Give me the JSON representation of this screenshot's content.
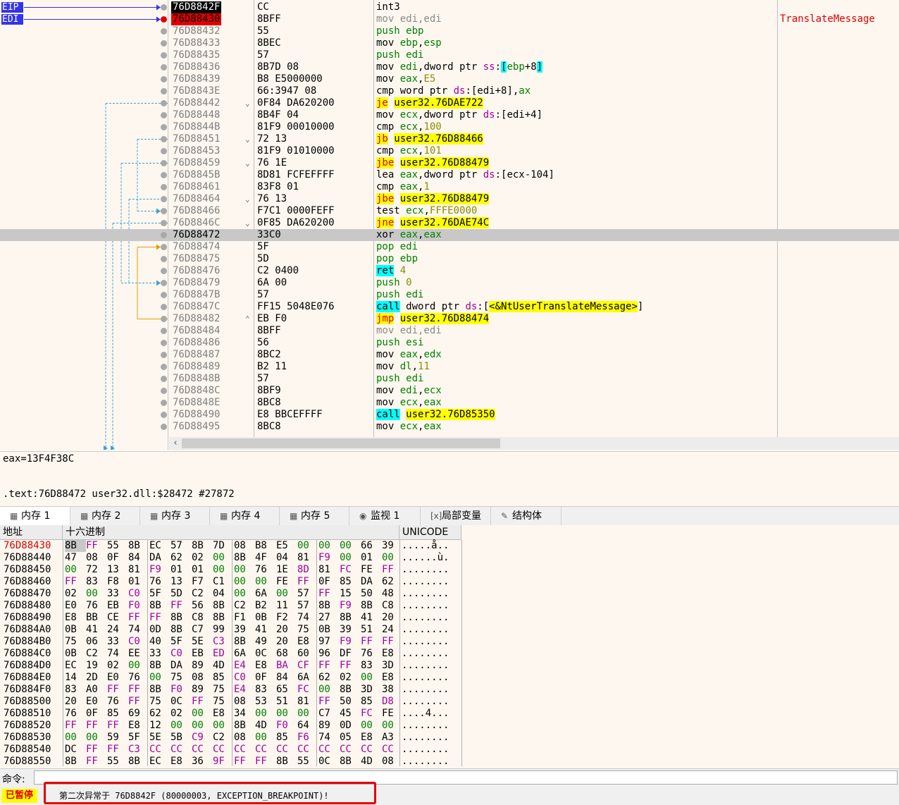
{
  "registers": [
    "EIP",
    "EDI"
  ],
  "disasm": [
    {
      "addr": "76D8842F",
      "bytes": "CC",
      "instr": [
        [
          "m",
          "int3"
        ]
      ],
      "comment": "",
      "state": "eip"
    },
    {
      "addr": "76D88430",
      "bytes": "8BFF",
      "instr": [
        [
          "g",
          "mov edi,edi"
        ]
      ],
      "comment": "TranslateMessage",
      "state": "bp"
    },
    {
      "addr": "76D88432",
      "bytes": "55",
      "instr": [
        [
          "r",
          "push ebp"
        ]
      ]
    },
    {
      "addr": "76D88433",
      "bytes": "8BEC",
      "instr": [
        [
          "p",
          "mov "
        ],
        [
          "r",
          "ebp"
        ],
        [
          "p",
          ","
        ],
        [
          "r",
          "esp"
        ]
      ]
    },
    {
      "addr": "76D88435",
      "bytes": "57",
      "instr": [
        [
          "r",
          "push edi"
        ]
      ]
    },
    {
      "addr": "76D88436",
      "bytes": "8B7D 08",
      "instr": [
        [
          "p",
          "mov "
        ],
        [
          "r",
          "edi"
        ],
        [
          "p",
          ",dword ptr "
        ],
        [
          "seg",
          "ss"
        ],
        [
          "p",
          ":"
        ],
        [
          "c",
          "["
        ],
        [
          "r",
          "ebp"
        ],
        [
          "p",
          "+8"
        ],
        [
          "c",
          "]"
        ]
      ]
    },
    {
      "addr": "76D88439",
      "bytes": "B8 E5000000",
      "instr": [
        [
          "p",
          "mov "
        ],
        [
          "r",
          "eax"
        ],
        [
          "p",
          ","
        ],
        [
          "n",
          "E5"
        ]
      ]
    },
    {
      "addr": "76D8843E",
      "bytes": "66:3947 08",
      "instr": [
        [
          "p",
          "cmp word ptr "
        ],
        [
          "seg",
          "ds"
        ],
        [
          "p",
          ":[edi+8],"
        ],
        [
          "r",
          "ax"
        ]
      ]
    },
    {
      "addr": "76D88442",
      "bytes": "0F84 DA620200",
      "arrow": "v",
      "instr": [
        [
          "jmp",
          "je"
        ],
        [
          "p",
          " "
        ],
        [
          "yb",
          "user32.76DAE722"
        ]
      ]
    },
    {
      "addr": "76D88448",
      "bytes": "8B4F 04",
      "instr": [
        [
          "p",
          "mov "
        ],
        [
          "r",
          "ecx"
        ],
        [
          "p",
          ",dword ptr "
        ],
        [
          "seg",
          "ds"
        ],
        [
          "p",
          ":[edi+4]"
        ]
      ]
    },
    {
      "addr": "76D8844B",
      "bytes": "81F9 00010000",
      "instr": [
        [
          "p",
          "cmp "
        ],
        [
          "r",
          "ecx"
        ],
        [
          "p",
          ","
        ],
        [
          "n",
          "100"
        ]
      ]
    },
    {
      "addr": "76D88451",
      "bytes": "72 13",
      "arrow": "v",
      "instr": [
        [
          "jmp",
          "jb"
        ],
        [
          "p",
          " "
        ],
        [
          "yb",
          "user32.76D88466"
        ]
      ]
    },
    {
      "addr": "76D88453",
      "bytes": "81F9 01010000",
      "instr": [
        [
          "p",
          "cmp "
        ],
        [
          "r",
          "ecx"
        ],
        [
          "p",
          ","
        ],
        [
          "n",
          "101"
        ]
      ]
    },
    {
      "addr": "76D88459",
      "bytes": "76 1E",
      "arrow": "v",
      "instr": [
        [
          "jmp",
          "jbe"
        ],
        [
          "p",
          " "
        ],
        [
          "yb",
          "user32.76D88479"
        ]
      ]
    },
    {
      "addr": "76D8845B",
      "bytes": "8D81 FCFEFFFF",
      "instr": [
        [
          "p",
          "lea "
        ],
        [
          "r",
          "eax"
        ],
        [
          "p",
          ",dword ptr "
        ],
        [
          "seg",
          "ds"
        ],
        [
          "p",
          ":[ecx-104]"
        ]
      ]
    },
    {
      "addr": "76D88461",
      "bytes": "83F8 01",
      "instr": [
        [
          "p",
          "cmp "
        ],
        [
          "r",
          "eax"
        ],
        [
          "p",
          ","
        ],
        [
          "n",
          "1"
        ]
      ]
    },
    {
      "addr": "76D88464",
      "bytes": "76 13",
      "arrow": "v",
      "instr": [
        [
          "jmp",
          "jbe"
        ],
        [
          "p",
          " "
        ],
        [
          "yb",
          "user32.76D88479"
        ]
      ]
    },
    {
      "addr": "76D88466",
      "bytes": "F7C1 0000FEFF",
      "instr": [
        [
          "p",
          "test "
        ],
        [
          "r",
          "ecx"
        ],
        [
          "p",
          ","
        ],
        [
          "n",
          "FFFE0000"
        ]
      ]
    },
    {
      "addr": "76D8846C",
      "bytes": "0F85 DA620200",
      "arrow": "v",
      "instr": [
        [
          "jmp",
          "jne"
        ],
        [
          "p",
          " "
        ],
        [
          "yb",
          "user32.76DAE74C"
        ]
      ]
    },
    {
      "addr": "76D88472",
      "bytes": "33C0",
      "instr": [
        [
          "p",
          "xor "
        ],
        [
          "r",
          "eax"
        ],
        [
          "p",
          ","
        ],
        [
          "r",
          "eax"
        ]
      ],
      "state": "cur"
    },
    {
      "addr": "76D88474",
      "bytes": "5F",
      "instr": [
        [
          "r",
          "pop edi"
        ]
      ]
    },
    {
      "addr": "76D88475",
      "bytes": "5D",
      "instr": [
        [
          "r",
          "pop ebp"
        ]
      ]
    },
    {
      "addr": "76D88476",
      "bytes": "C2 0400",
      "instr": [
        [
          "cy",
          "ret"
        ],
        [
          "p",
          " "
        ],
        [
          "n",
          "4"
        ]
      ]
    },
    {
      "addr": "76D88479",
      "bytes": "6A 00",
      "instr": [
        [
          "r",
          "push "
        ],
        [
          "n",
          "0"
        ]
      ]
    },
    {
      "addr": "76D8847B",
      "bytes": "57",
      "instr": [
        [
          "r",
          "push edi"
        ]
      ]
    },
    {
      "addr": "76D8847C",
      "bytes": "FF15 5048E076",
      "instr": [
        [
          "cy",
          "call"
        ],
        [
          "p",
          " dword ptr "
        ],
        [
          "seg",
          "ds"
        ],
        [
          "p",
          ":["
        ],
        [
          "yb",
          "<&NtUserTranslateMessage>"
        ],
        [
          "p",
          "]"
        ]
      ]
    },
    {
      "addr": "76D88482",
      "bytes": "EB F0",
      "arrow": "^",
      "instr": [
        [
          "jmp",
          "jmp"
        ],
        [
          "p",
          " "
        ],
        [
          "yb",
          "user32.76D88474"
        ]
      ]
    },
    {
      "addr": "76D88484",
      "bytes": "8BFF",
      "instr": [
        [
          "g",
          "mov edi,edi"
        ]
      ]
    },
    {
      "addr": "76D88486",
      "bytes": "56",
      "instr": [
        [
          "r",
          "push esi"
        ]
      ]
    },
    {
      "addr": "76D88487",
      "bytes": "8BC2",
      "instr": [
        [
          "p",
          "mov "
        ],
        [
          "r",
          "eax"
        ],
        [
          "p",
          ","
        ],
        [
          "r",
          "edx"
        ]
      ]
    },
    {
      "addr": "76D88489",
      "bytes": "B2 11",
      "instr": [
        [
          "p",
          "mov "
        ],
        [
          "r",
          "dl"
        ],
        [
          "p",
          ","
        ],
        [
          "n",
          "11"
        ]
      ]
    },
    {
      "addr": "76D8848B",
      "bytes": "57",
      "instr": [
        [
          "r",
          "push edi"
        ]
      ]
    },
    {
      "addr": "76D8848C",
      "bytes": "8BF9",
      "instr": [
        [
          "p",
          "mov "
        ],
        [
          "r",
          "edi"
        ],
        [
          "p",
          ","
        ],
        [
          "r",
          "ecx"
        ]
      ]
    },
    {
      "addr": "76D8848E",
      "bytes": "8BC8",
      "instr": [
        [
          "p",
          "mov "
        ],
        [
          "r",
          "ecx"
        ],
        [
          "p",
          ","
        ],
        [
          "r",
          "eax"
        ]
      ]
    },
    {
      "addr": "76D88490",
      "bytes": "E8 BBCEFFFF",
      "instr": [
        [
          "cy",
          "call"
        ],
        [
          "p",
          " "
        ],
        [
          "yb",
          "user32.76D85350"
        ]
      ]
    },
    {
      "addr": "76D88495",
      "bytes": "8BC8",
      "instr": [
        [
          "p",
          "mov "
        ],
        [
          "r",
          "ecx"
        ],
        [
          "p",
          ","
        ],
        [
          "r",
          "eax"
        ]
      ]
    }
  ],
  "info": {
    "line1": "eax=13F4F38C",
    "line2": ".text:76D88472 user32.dll:$28472 #27872"
  },
  "tabs": [
    {
      "label": "内存 1",
      "icon": "memory-icon"
    },
    {
      "label": "内存 2",
      "icon": "memory-icon"
    },
    {
      "label": "内存 3",
      "icon": "memory-icon"
    },
    {
      "label": "内存 4",
      "icon": "memory-icon"
    },
    {
      "label": "内存 5",
      "icon": "memory-icon"
    },
    {
      "label": "监视 1",
      "icon": "watch-icon"
    },
    {
      "label": "局部变量",
      "icon": "locals-icon"
    },
    {
      "label": "结构体",
      "icon": "struct-icon"
    }
  ],
  "dump": {
    "headers": {
      "addr": "地址",
      "hex": "十六进制",
      "unicode": "UNICODE"
    },
    "rows": [
      {
        "addr": "76D88430",
        "hex": "8B FF 55 8B EC 57 8B 7D 08 B8 E5 00 00 00 66 39",
        "uni": ".....å.."
      },
      {
        "addr": "76D88440",
        "hex": "47 08 0F 84 DA 62 02 00 8B 4F 04 81 F9 00 01 00",
        "uni": "......ù."
      },
      {
        "addr": "76D88450",
        "hex": "00 72 13 81 F9 01 01 00 00 76 1E 8D 81 FC FE FF",
        "uni": "........"
      },
      {
        "addr": "76D88460",
        "hex": "FF 83 F8 01 76 13 F7 C1 00 00 FE FF 0F 85 DA 62",
        "uni": "........"
      },
      {
        "addr": "76D88470",
        "hex": "02 00 33 C0 5F 5D C2 04 00 6A 00 57 FF 15 50 48",
        "uni": "........"
      },
      {
        "addr": "76D88480",
        "hex": "E0 76 EB F0 8B FF 56 8B C2 B2 11 57 8B F9 8B C8",
        "uni": "........"
      },
      {
        "addr": "76D88490",
        "hex": "E8 BB CE FF FF 8B C8 8B F1 0B F2 74 27 8B 41 20",
        "uni": "........"
      },
      {
        "addr": "76D884A0",
        "hex": "0B 41 24 74 0D 8B C7 99 39 41 20 75 0B 39 51 24",
        "uni": "........"
      },
      {
        "addr": "76D884B0",
        "hex": "75 06 33 C0 40 5F 5E C3 8B 49 20 E8 97 F9 FF FF",
        "uni": "........"
      },
      {
        "addr": "76D884C0",
        "hex": "0B C2 74 EE 33 C0 EB ED 6A 0C 68 60 96 DF 76 E8",
        "uni": "........"
      },
      {
        "addr": "76D884D0",
        "hex": "EC 19 02 00 8B DA 89 4D E4 E8 BA CF FF FF 83 3D",
        "uni": "........"
      },
      {
        "addr": "76D884E0",
        "hex": "14 2D E0 76 00 75 08 85 C0 0F 84 6A 62 02 00 E8",
        "uni": "........"
      },
      {
        "addr": "76D884F0",
        "hex": "83 A0 FF FF 8B F0 89 75 E4 83 65 FC 00 8B 3D 38",
        "uni": "........"
      },
      {
        "addr": "76D88500",
        "hex": "20 E0 76 FF 75 0C FF 75 08 53 51 81 FF 50 85 D8",
        "uni": "........"
      },
      {
        "addr": "76D88510",
        "hex": "76 0F 85 69 62 02 00 E8 34 00 00 00 C7 45 FC FE",
        "uni": "....4..."
      },
      {
        "addr": "76D88520",
        "hex": "FF FF FF E8 12 00 00 00 8B 4D F0 64 89 0D 00 00",
        "uni": "........"
      },
      {
        "addr": "76D88530",
        "hex": "00 00 59 5F 5E 5B C9 C2 08 00 85 F6 74 05 E8 A3",
        "uni": "........"
      },
      {
        "addr": "76D88540",
        "hex": "DC FF FF C3 CC CC CC CC CC CC CC CC CC CC CC CC",
        "uni": "........"
      },
      {
        "addr": "76D88550",
        "hex": "8B FF 55 8B EC E8 36 9F FF FF 8B 55 0C 8B 4D 08",
        "uni": "........"
      }
    ]
  },
  "command": {
    "label": "命令:",
    "value": ""
  },
  "status": {
    "paused": "已暂停",
    "message": "第二次异常于 76D8842F (80000003, EXCEPTION_BREAKPOINT)!"
  },
  "colors": {
    "accent": "#3333ee",
    "breakpoint": "#e00000",
    "highlight": "#ffff00",
    "call": "#00ffff"
  }
}
